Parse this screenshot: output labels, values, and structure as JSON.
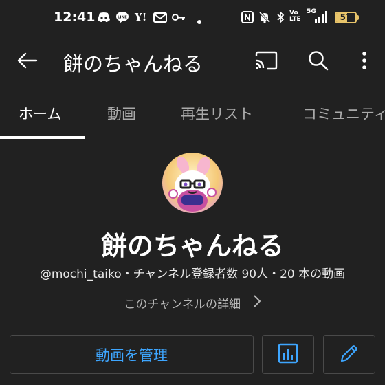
{
  "status_bar": {
    "time": "12:41",
    "left_icons": [
      "discord-icon",
      "line-icon",
      "yahoo-icon",
      "mail-icon",
      "key-icon"
    ],
    "yahoo_text": "Y!",
    "right_icons": [
      "nfc-icon",
      "bell-off-icon",
      "bluetooth-icon",
      "volte-icon",
      "5g-signal-icon"
    ],
    "volte_text": "Vo LTE",
    "network_text": "5G",
    "battery_level": "57",
    "battery_color": "#e8c46a"
  },
  "app_bar": {
    "title": "餅のちゃんねる",
    "icons": [
      "back-arrow-icon",
      "cast-icon",
      "search-icon",
      "more-vert-icon"
    ]
  },
  "tabs": [
    {
      "label": "ホーム",
      "active": true
    },
    {
      "label": "動画",
      "active": false
    },
    {
      "label": "再生リスト",
      "active": false
    },
    {
      "label": "コミュニティ",
      "active": false
    }
  ],
  "channel": {
    "name": "餅のちゃんねる",
    "meta": "@mochi_taiko・チャンネル登録者数 90人・20 本の動画",
    "details_link": "このチャンネルの詳細"
  },
  "actions": {
    "manage_label": "動画を管理",
    "analytics_icon": "analytics-icon",
    "edit_icon": "pencil-icon"
  },
  "colors": {
    "background": "#212121",
    "accent": "#3ea6ff",
    "tab_indicator": "#ffffff"
  }
}
